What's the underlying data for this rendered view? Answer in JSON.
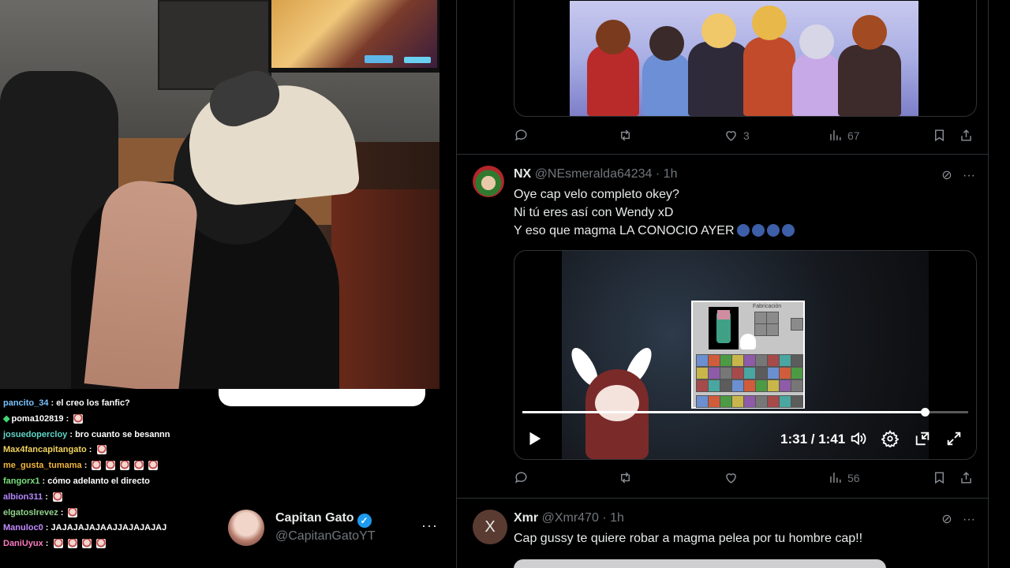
{
  "chat": {
    "lines": [
      {
        "user": "pancito_34",
        "user_color": "#7ac2ff",
        "message": "el creo los fanfic?",
        "emotes": 0,
        "badge": false
      },
      {
        "user": "poma102819",
        "user_color": "#ffffff",
        "message": "",
        "emotes": 1,
        "badge": true
      },
      {
        "user": "josuedopercloy",
        "user_color": "#5ed6c8",
        "message": "bro cuanto se besannn",
        "emotes": 0,
        "badge": false
      },
      {
        "user": "Max4fancapitangato",
        "user_color": "#f2d45c",
        "message": "",
        "emotes": 1,
        "badge": false
      },
      {
        "user": "me_gusta_tumama",
        "user_color": "#f2b53c",
        "message": "",
        "emotes": 5,
        "badge": false
      },
      {
        "user": "fangorx1",
        "user_color": "#79e07e",
        "message": "cómo adelanto el directo",
        "emotes": 0,
        "badge": false
      },
      {
        "user": "albion311",
        "user_color": "#b487ff",
        "message": "",
        "emotes": 1,
        "badge": false
      },
      {
        "user": "elgatoslrevez",
        "user_color": "#8fd18a",
        "message": "",
        "emotes": 1,
        "badge": false
      },
      {
        "user": "Manuloc0",
        "user_color": "#c38bff",
        "message": "JAJAJAJAJAAJJAJAJAJAJ",
        "emotes": 0,
        "badge": false
      },
      {
        "user": "DaniUyux",
        "user_color": "#ff7bc2",
        "message": "",
        "emotes": 4,
        "badge": false
      }
    ]
  },
  "profile": {
    "name": "Capitan Gato",
    "handle": "@CapitanGatoYT",
    "more": "···"
  },
  "tweet1": {
    "actions": {
      "replies": "",
      "reposts": "",
      "likes": "3",
      "views": "67"
    }
  },
  "tweet2": {
    "name": "NX",
    "handle": "@NEsmeralda64234",
    "time": "· 1h",
    "lines": [
      "Oye cap velo completo okey?",
      "Ni tú eres así con Wendy xD",
      "Y eso que magma LA CONOCIO AYER"
    ],
    "video": {
      "time": "1:31 / 1:41",
      "progress": 0.902,
      "inventory_title": "Fabricación"
    },
    "actions": {
      "replies": "",
      "reposts": "",
      "likes": "",
      "views": "56"
    }
  },
  "tweet3": {
    "name": "Xmr",
    "handle": "@Xmr470",
    "time": "· 1h",
    "avatar_letter": "X",
    "text": "Cap gussy te quiere robar a magma pelea por tu hombre cap!!"
  },
  "colors": {
    "accent": "#1d9bf0",
    "text": "#e7e9ea",
    "muted": "#71767b",
    "border": "#2f3336"
  }
}
